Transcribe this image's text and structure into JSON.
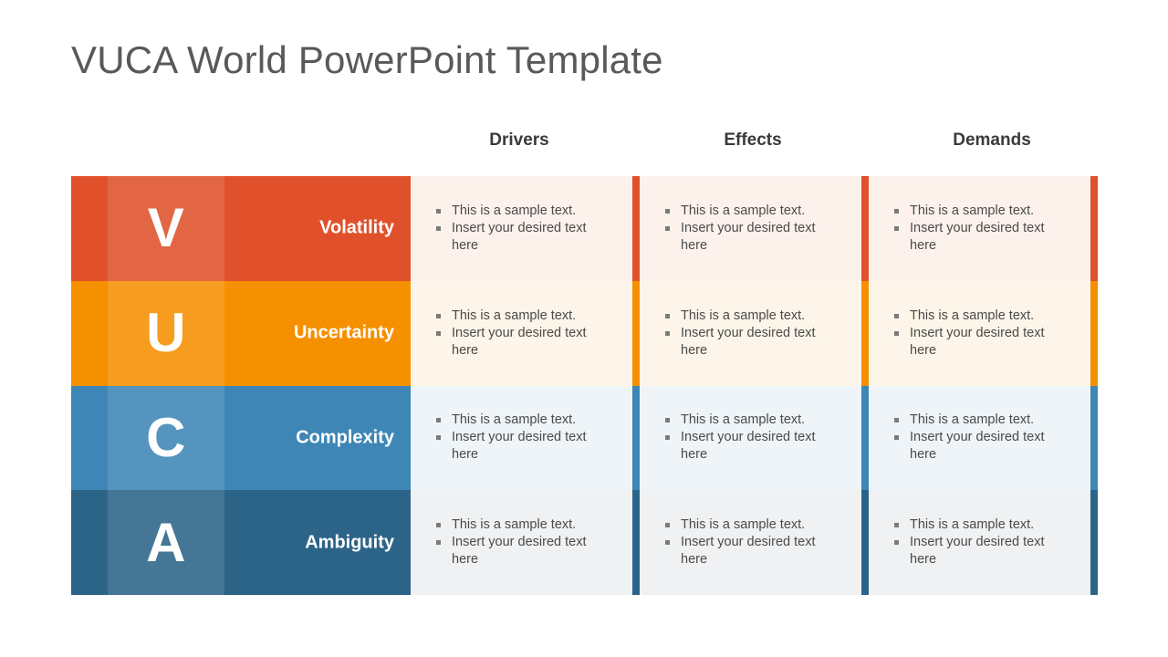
{
  "title": "VUCA World PowerPoint Template",
  "columns": [
    {
      "label": "Drivers"
    },
    {
      "label": "Effects"
    },
    {
      "label": "Demands"
    }
  ],
  "bullet_text": {
    "line1": "This is a sample text.",
    "line2": "Insert your desired text here"
  },
  "rows": [
    {
      "letter": "V",
      "label": "Volatility",
      "band_color": "#e0512b",
      "accent_color": "#e0512b",
      "panel_bg": "#fdf1ec",
      "bullets": [
        "This is a sample text.",
        "Insert your desired text here"
      ]
    },
    {
      "letter": "U",
      "label": "Uncertainty",
      "band_color": "#f59000",
      "accent_color": "#f59000",
      "panel_bg": "#fdf5e9",
      "bullets": [
        "This is a sample text.",
        "Insert your desired text here"
      ]
    },
    {
      "letter": "C",
      "label": "Complexity",
      "band_color": "#3d86b5",
      "accent_color": "#3d86b5",
      "panel_bg": "#eef4f8",
      "bullets": [
        "This is a sample text.",
        "Insert your desired text here"
      ]
    },
    {
      "letter": "A",
      "label": "Ambiguity",
      "band_color": "#2c6488",
      "accent_color": "#2c6488",
      "panel_bg": "#eff1f3",
      "bullets": [
        "This is a sample text.",
        "Insert your desired text here"
      ]
    }
  ],
  "theme": {
    "title_color": "#58595b",
    "header_color": "#3a3a3c",
    "bullet_color": "#4a4a4a",
    "background": "#ffffff"
  }
}
